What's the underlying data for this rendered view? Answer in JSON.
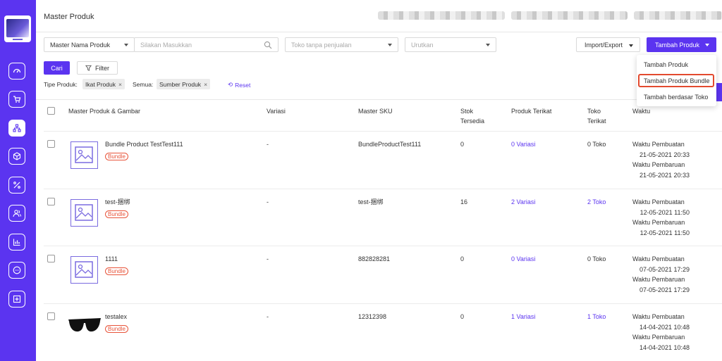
{
  "sidebar": {
    "icons": [
      "dashboard-icon",
      "cart-icon",
      "hierarchy-icon",
      "box-icon",
      "percent-icon",
      "users-icon",
      "chart-icon",
      "chat-icon",
      "plus-square-icon"
    ]
  },
  "header": {
    "title": "Master Produk"
  },
  "filters": {
    "master_select": "Master Nama Produk",
    "search_placeholder": "Silakan Masukkan",
    "toko_placeholder": "Toko tanpa penjualan",
    "urutkan_placeholder": "Urutkan",
    "import_export": "Import/Export",
    "tambah_produk": "Tambah Produk",
    "cari": "Cari",
    "filter": "Filter",
    "tipe_label": "Tipe Produk:",
    "tipe_tag": "Ikat Produk",
    "semua_label": "Semua:",
    "semua_tag": "Sumber Produk",
    "reset": "Reset"
  },
  "dropdown": {
    "items": [
      "Tambah Produk",
      "Tambah Produk Bundle",
      "Tambah berdasar Toko"
    ]
  },
  "table": {
    "headers": {
      "produk": "Master Produk & Gambar",
      "variasi": "Variasi",
      "sku": "Master SKU",
      "stok_1": "Stok",
      "stok_2": "Tersedia",
      "terikat": "Produk Terikat",
      "toko_1": "Toko",
      "toko_2": "Terikat",
      "waktu": "Waktu"
    },
    "badge": "Bundle",
    "label_buat": "Waktu Pembuatan",
    "label_baru": "Waktu Pembaruan",
    "rows": [
      {
        "name": "Bundle Product TestTest111",
        "variasi": "-",
        "sku": "BundleProductTest111",
        "stok": "0",
        "terikat": "0 Variasi",
        "toko": "0 Toko",
        "buat": "21-05-2021 20:33",
        "baru": "21-05-2021 20:33"
      },
      {
        "name": "test-捆绑",
        "variasi": "-",
        "sku": "test-捆绑",
        "stok": "16",
        "terikat": "2 Variasi",
        "toko": "2 Toko",
        "buat": "12-05-2021 11:50",
        "baru": "12-05-2021 11:50"
      },
      {
        "name": "1111",
        "variasi": "-",
        "sku": "882828281",
        "stok": "0",
        "terikat": "0 Variasi",
        "toko": "0 Toko",
        "buat": "07-05-2021 17:29",
        "baru": "07-05-2021 17:29"
      },
      {
        "name": "testalex",
        "variasi": "-",
        "sku": "12312398",
        "stok": "0",
        "terikat": "1 Variasi",
        "toko": "1 Toko",
        "buat": "14-04-2021 10:48",
        "baru": "14-04-2021 10:48"
      }
    ]
  },
  "colors": {
    "brand": "#5b34f0",
    "badge": "#e8543a",
    "highlight": "#e34a2f"
  }
}
